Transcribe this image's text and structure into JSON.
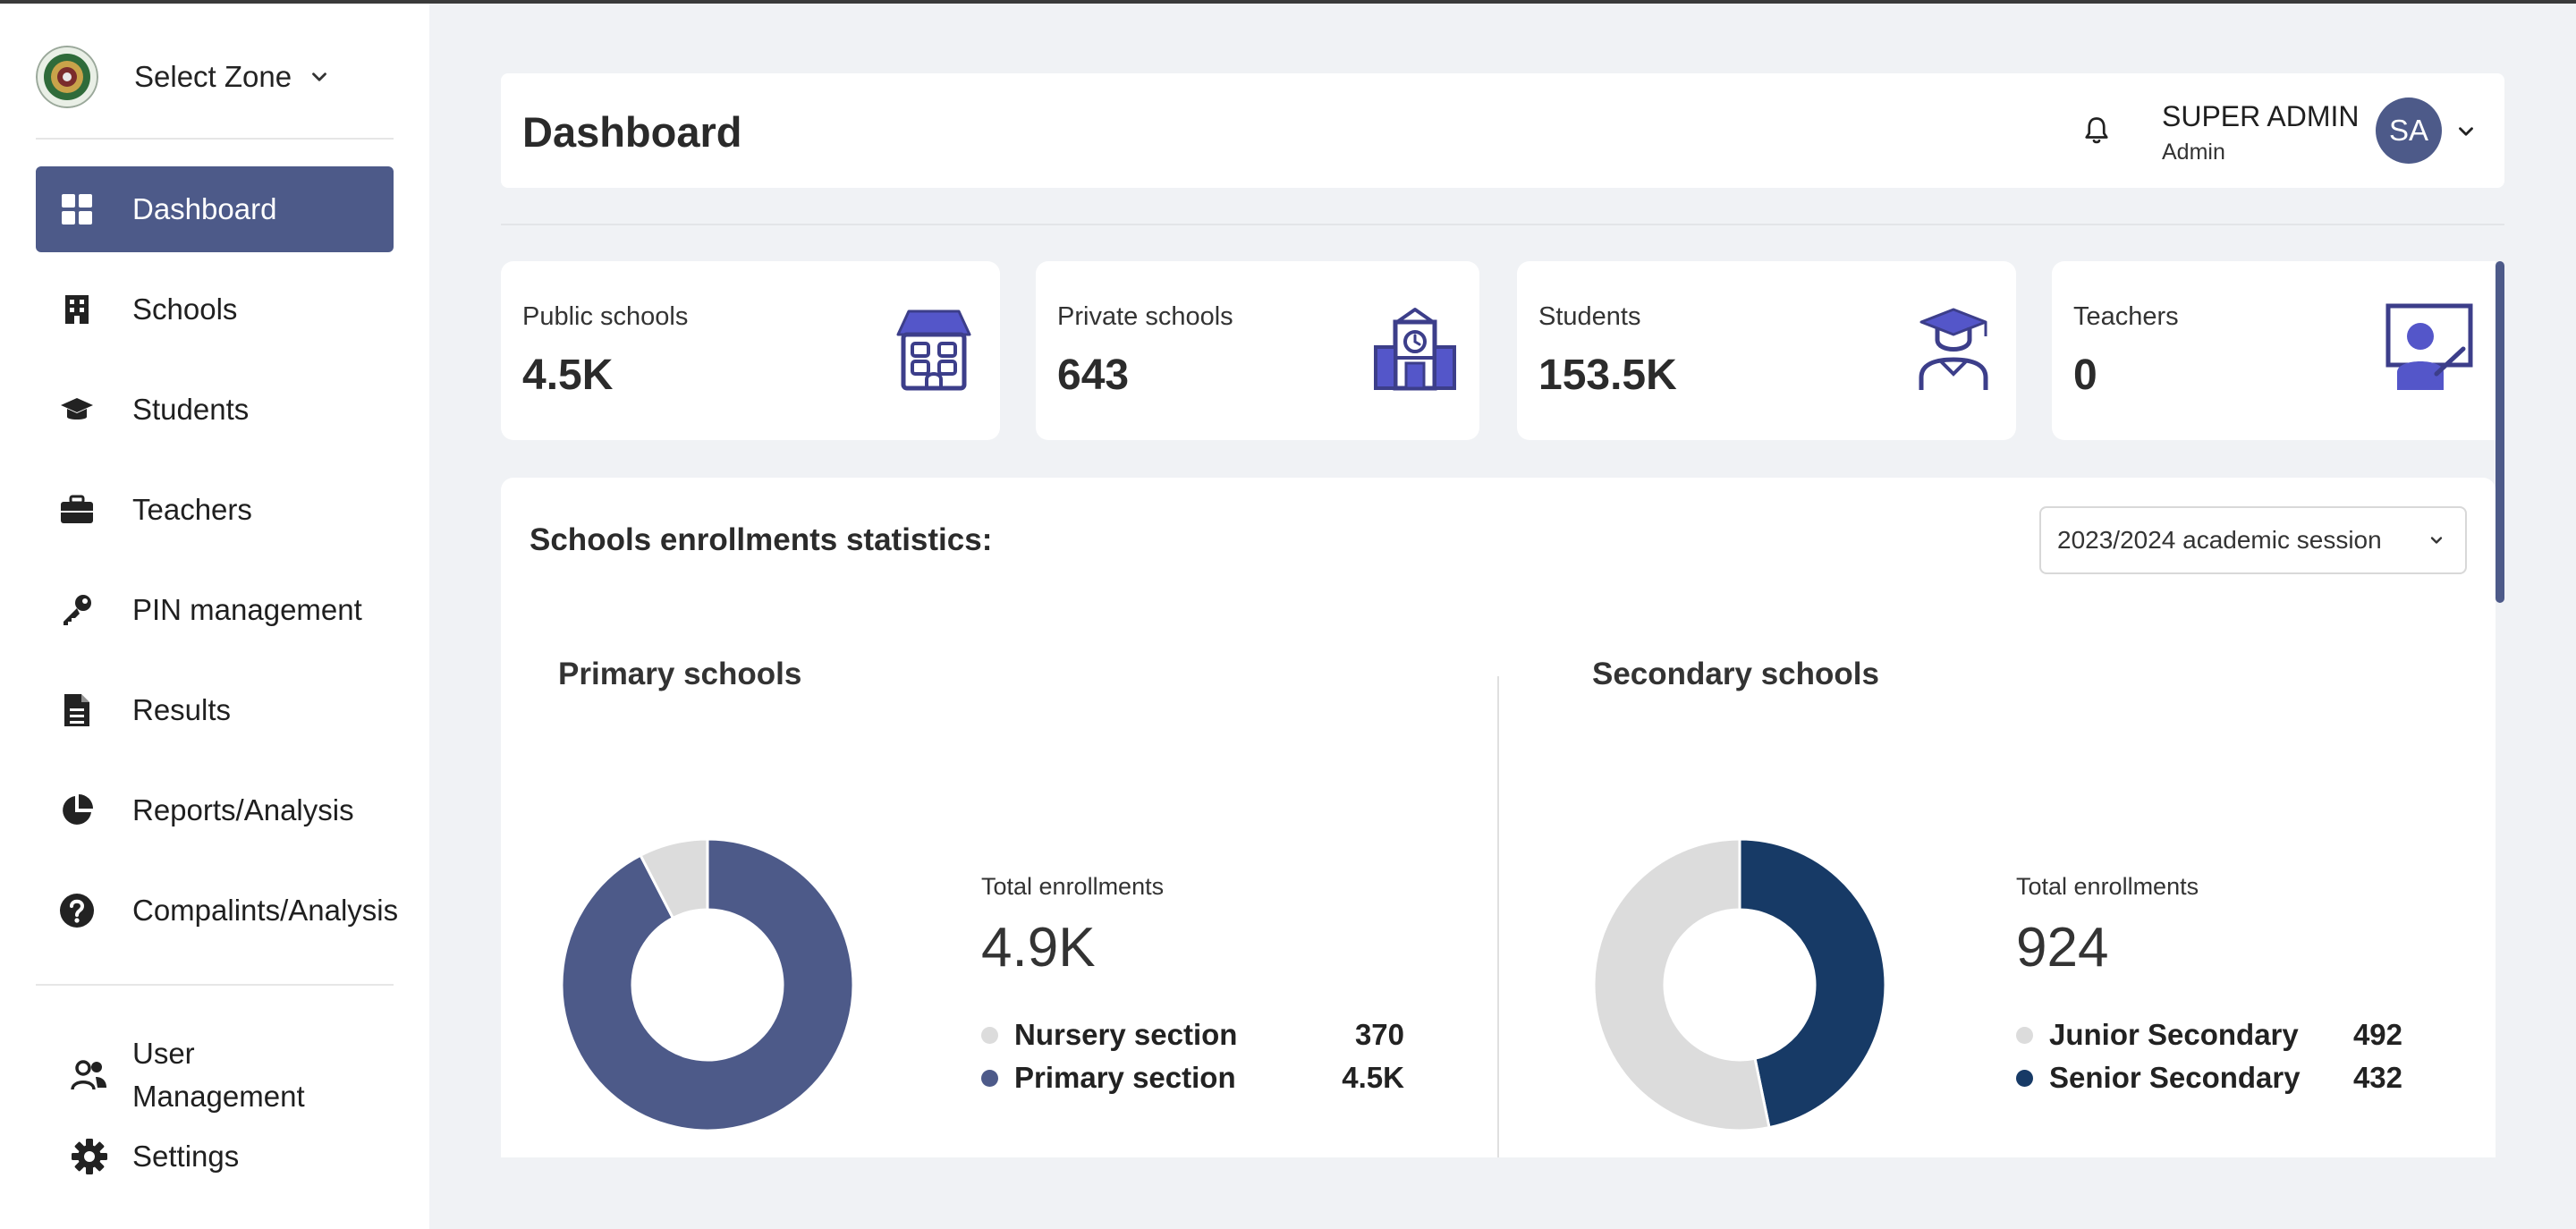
{
  "sidebar": {
    "zone_label": "Select Zone",
    "nav": [
      {
        "label": "Dashboard",
        "icon": "grid-icon",
        "active": true
      },
      {
        "label": "Schools",
        "icon": "building-icon"
      },
      {
        "label": "Students",
        "icon": "graduation-cap-icon"
      },
      {
        "label": "Teachers",
        "icon": "briefcase-icon"
      },
      {
        "label": "PIN management",
        "icon": "key-icon"
      },
      {
        "label": "Results",
        "icon": "document-icon"
      },
      {
        "label": "Reports/Analysis",
        "icon": "pie-chart-icon"
      },
      {
        "label": "Compalints/Analysis",
        "icon": "question-circle-icon"
      }
    ],
    "bottom": [
      {
        "label_line1": "User",
        "label_line2": "Management",
        "icon": "users-icon"
      },
      {
        "label": "Settings",
        "icon": "gear-icon"
      }
    ]
  },
  "header": {
    "title": "Dashboard",
    "user_name": "SUPER ADMIN",
    "user_role": "Admin",
    "avatar_initials": "SA"
  },
  "stats": [
    {
      "label": "Public schools",
      "value": "4.5K",
      "icon": "house-icon"
    },
    {
      "label": "Private schools",
      "value": "643",
      "icon": "clock-building-icon"
    },
    {
      "label": "Students",
      "value": "153.5K",
      "icon": "graduate-icon"
    },
    {
      "label": "Teachers",
      "value": "0",
      "icon": "teacher-board-icon"
    }
  ],
  "enrollment": {
    "title": "Schools enrollments statistics:",
    "session": "2023/2024 academic session",
    "primary": {
      "title": "Primary schools",
      "total_label": "Total enrollments",
      "total_value": "4.9K",
      "legend": [
        {
          "label": "Nursery section",
          "value": "370"
        },
        {
          "label": "Primary section",
          "value": "4.5K"
        }
      ]
    },
    "secondary": {
      "title": "Secondary schools",
      "total_label": "Total enrollments",
      "total_value": "924",
      "legend": [
        {
          "label": "Junior Secondary",
          "value": "492"
        },
        {
          "label": "Senior Secondary",
          "value": "432"
        }
      ]
    }
  },
  "colors": {
    "accent": "#4d5a89",
    "navy": "#173a66",
    "gray_slice": "#dcdcdc"
  },
  "chart_data": [
    {
      "type": "pie",
      "title": "Primary schools",
      "categories": [
        "Nursery section",
        "Primary section"
      ],
      "values": [
        370,
        4500
      ],
      "colors": [
        "#dcdcdc",
        "#4d5a89"
      ]
    },
    {
      "type": "pie",
      "title": "Secondary schools",
      "categories": [
        "Junior Secondary",
        "Senior Secondary"
      ],
      "values": [
        492,
        432
      ],
      "colors": [
        "#dcdcdc",
        "#173a66"
      ]
    }
  ]
}
